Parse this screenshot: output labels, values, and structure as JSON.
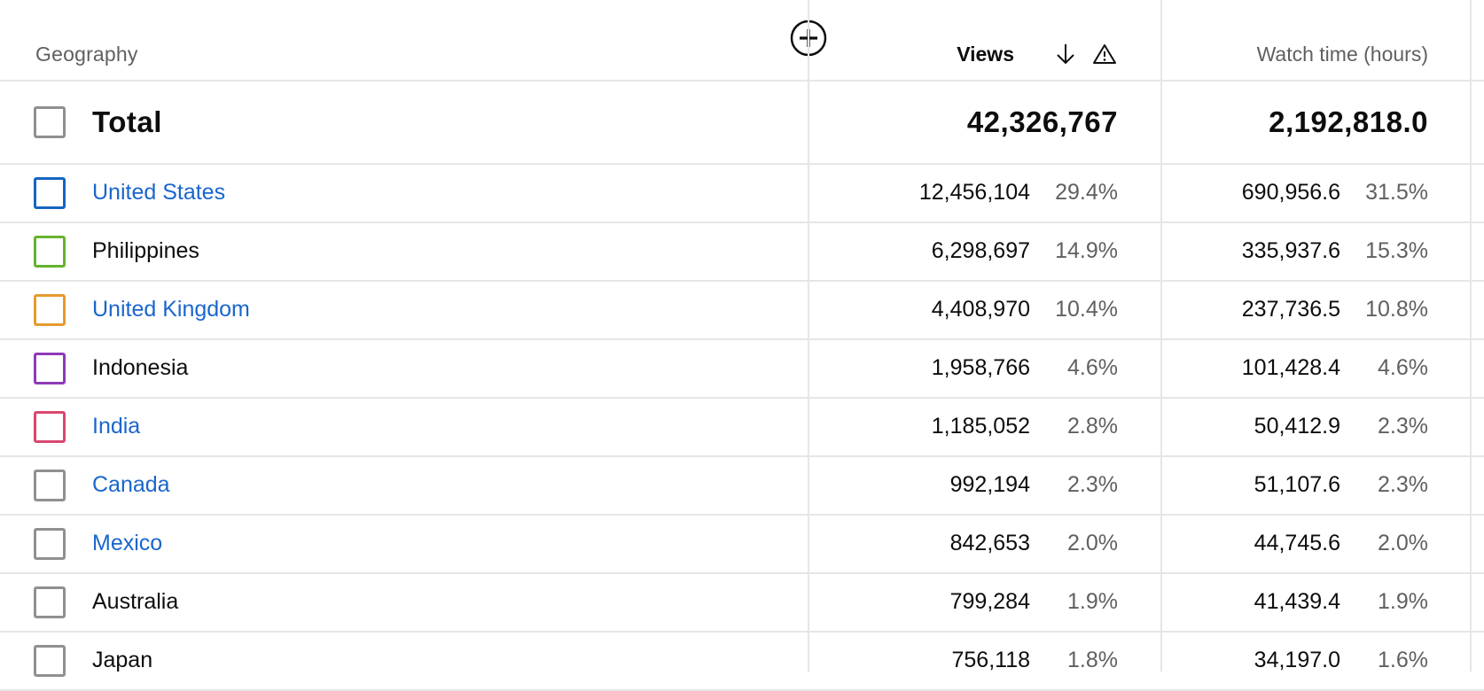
{
  "header": {
    "geography_label": "Geography",
    "views_label": "Views",
    "watch_label": "Watch time (hours)",
    "add_metric_icon": "add-circle-icon",
    "sort_icon": "arrow-down-icon",
    "warning_icon": "warning-triangle-icon"
  },
  "total": {
    "label": "Total",
    "views": "42,326,767",
    "watch_time": "2,192,818.0"
  },
  "rows": [
    {
      "country": "United States",
      "link": true,
      "color": "#1565c0",
      "views": "12,456,104",
      "views_pct": "29.4%",
      "watch_time": "690,956.6",
      "watch_pct": "31.5%"
    },
    {
      "country": "Philippines",
      "link": false,
      "color": "#66b32e",
      "views": "6,298,697",
      "views_pct": "14.9%",
      "watch_time": "335,937.6",
      "watch_pct": "15.3%"
    },
    {
      "country": "United Kingdom",
      "link": true,
      "color": "#e69a2e",
      "views": "4,408,970",
      "views_pct": "10.4%",
      "watch_time": "237,736.5",
      "watch_pct": "10.8%"
    },
    {
      "country": "Indonesia",
      "link": false,
      "color": "#8e3ab8",
      "views": "1,958,766",
      "views_pct": "4.6%",
      "watch_time": "101,428.4",
      "watch_pct": "4.6%"
    },
    {
      "country": "India",
      "link": true,
      "color": "#d9476e",
      "views": "1,185,052",
      "views_pct": "2.8%",
      "watch_time": "50,412.9",
      "watch_pct": "2.3%"
    },
    {
      "country": "Canada",
      "link": true,
      "color": "#909090",
      "views": "992,194",
      "views_pct": "2.3%",
      "watch_time": "51,107.6",
      "watch_pct": "2.3%"
    },
    {
      "country": "Mexico",
      "link": true,
      "color": "#909090",
      "views": "842,653",
      "views_pct": "2.0%",
      "watch_time": "44,745.6",
      "watch_pct": "2.0%"
    },
    {
      "country": "Australia",
      "link": false,
      "color": "#909090",
      "views": "799,284",
      "views_pct": "1.9%",
      "watch_time": "41,439.4",
      "watch_pct": "1.9%"
    },
    {
      "country": "Japan",
      "link": false,
      "color": "#909090",
      "views": "756,118",
      "views_pct": "1.8%",
      "watch_time": "34,197.0",
      "watch_pct": "1.6%"
    }
  ]
}
